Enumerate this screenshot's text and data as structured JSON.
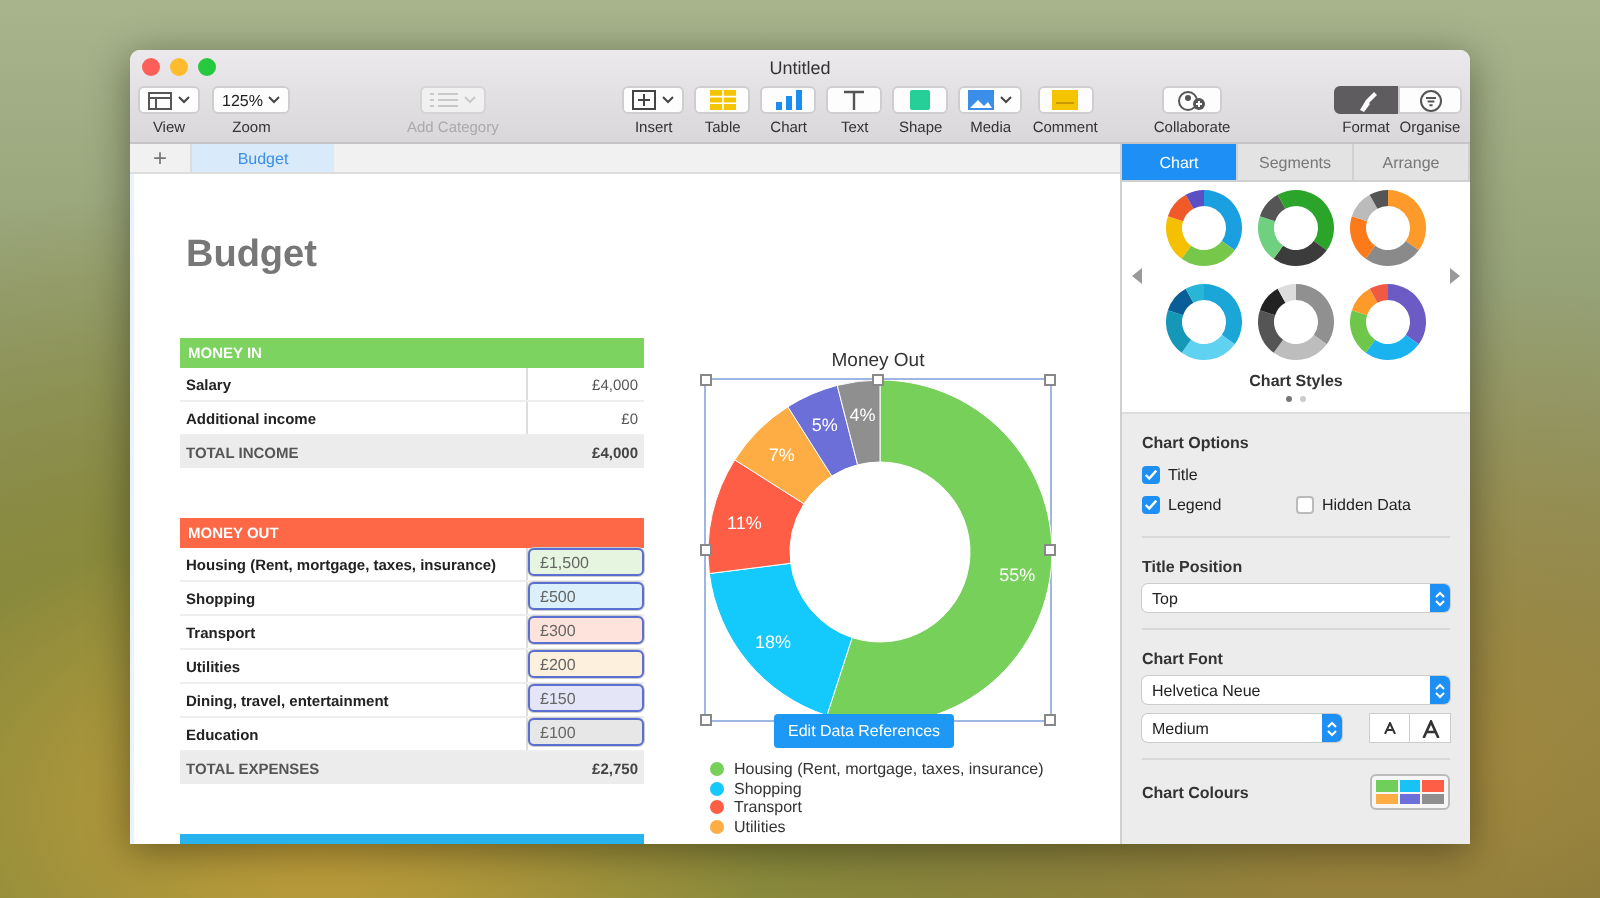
{
  "window": {
    "title": "Untitled"
  },
  "toolbar": [
    {
      "label": "View",
      "kind": "view",
      "disabled": false,
      "selected": false
    },
    {
      "label": "Zoom",
      "kind": "zoom",
      "value": "125%",
      "disabled": false,
      "selected": false
    },
    {
      "label": "Add Category",
      "kind": "category",
      "disabled": true,
      "selected": false
    },
    {
      "label": "Insert",
      "kind": "insert",
      "disabled": false,
      "selected": false
    },
    {
      "label": "Table",
      "kind": "table",
      "disabled": false,
      "selected": false
    },
    {
      "label": "Chart",
      "kind": "chart",
      "disabled": false,
      "selected": false
    },
    {
      "label": "Text",
      "kind": "text",
      "disabled": false,
      "selected": false
    },
    {
      "label": "Shape",
      "kind": "shape",
      "disabled": false,
      "selected": false
    },
    {
      "label": "Media",
      "kind": "media",
      "disabled": false,
      "selected": false
    },
    {
      "label": "Comment",
      "kind": "comment",
      "disabled": false,
      "selected": false
    },
    {
      "label": "Collaborate",
      "kind": "collaborate",
      "disabled": false,
      "selected": false
    },
    {
      "label": "Format",
      "kind": "format",
      "disabled": false,
      "selected": true
    },
    {
      "label": "Organise",
      "kind": "organise",
      "disabled": false,
      "selected": false
    }
  ],
  "add_sheet": "+",
  "sheet_tabs": [
    {
      "label": "Budget",
      "selected": true
    }
  ],
  "document": {
    "title": "Budget",
    "tables": [
      {
        "title": "MONEY IN",
        "color": "#7dd35f",
        "rows": [
          {
            "label": "Salary",
            "value": "£4,000",
            "selected": false
          },
          {
            "label": "Additional income",
            "value": "£0",
            "selected": false
          }
        ],
        "total": {
          "label": "TOTAL INCOME",
          "value": "£4,000"
        }
      },
      {
        "title": "MONEY OUT",
        "color": "#fe6846",
        "rows": [
          {
            "label": "Housing (Rent, mortgage, taxes, insurance)",
            "value": "£1,500",
            "selected": true,
            "color": "#e6f5df"
          },
          {
            "label": "Shopping",
            "value": "£500",
            "selected": true,
            "color": "#dcf0fb"
          },
          {
            "label": "Transport",
            "value": "£300",
            "selected": true,
            "color": "#fde3db"
          },
          {
            "label": "Utilities",
            "value": "£200",
            "selected": true,
            "color": "#fdf0dc"
          },
          {
            "label": "Dining, travel, entertainment",
            "value": "£150",
            "selected": true,
            "color": "#e4e5f6"
          },
          {
            "label": "Education",
            "value": "£100",
            "selected": true,
            "color": "#e7e7e7"
          }
        ],
        "total": {
          "label": "TOTAL EXPENSES",
          "value": "£2,750"
        }
      }
    ],
    "chart": {
      "chart_data": {
        "type": "donut",
        "title": "Money Out",
        "values": [
          55,
          18,
          11,
          7,
          5,
          4
        ],
        "value_labels": [
          "55%",
          "18%",
          "11%",
          "7%",
          "5%",
          "4%"
        ]
      },
      "slices": [
        {
          "color": "#76d05a"
        },
        {
          "color": "#14c9fc"
        },
        {
          "color": "#fd5e45"
        },
        {
          "color": "#fdad43"
        },
        {
          "color": "#6d6fd8"
        },
        {
          "color": "#8f8f8f"
        }
      ],
      "selected": true,
      "edit_button": "Edit Data References",
      "legend": [
        {
          "label": "Housing (Rent, mortgage, taxes, insurance)",
          "color": "#76d05a"
        },
        {
          "label": "Shopping",
          "color": "#14c9fc"
        },
        {
          "label": "Transport",
          "color": "#fd5e45"
        },
        {
          "label": "Utilities",
          "color": "#fdad43"
        }
      ]
    }
  },
  "sidebar": {
    "tabs": [
      {
        "label": "Chart",
        "selected": true
      },
      {
        "label": "Segments",
        "selected": false
      },
      {
        "label": "Arrange",
        "selected": false
      }
    ],
    "styles_label": "Chart Styles",
    "style_pages": [
      {
        "selected": true
      },
      {
        "selected": false
      }
    ],
    "options_heading": "Chart Options",
    "options": [
      {
        "label": "Title",
        "checked": true
      },
      {
        "label": "Legend",
        "checked": true
      },
      {
        "label": "Hidden Data",
        "checked": false
      }
    ],
    "title_position_heading": "Title Position",
    "title_position": "Top",
    "font_heading": "Chart Font",
    "font": "Helvetica Neue",
    "font_weight": "Medium",
    "colours_heading": "Chart Colours"
  }
}
